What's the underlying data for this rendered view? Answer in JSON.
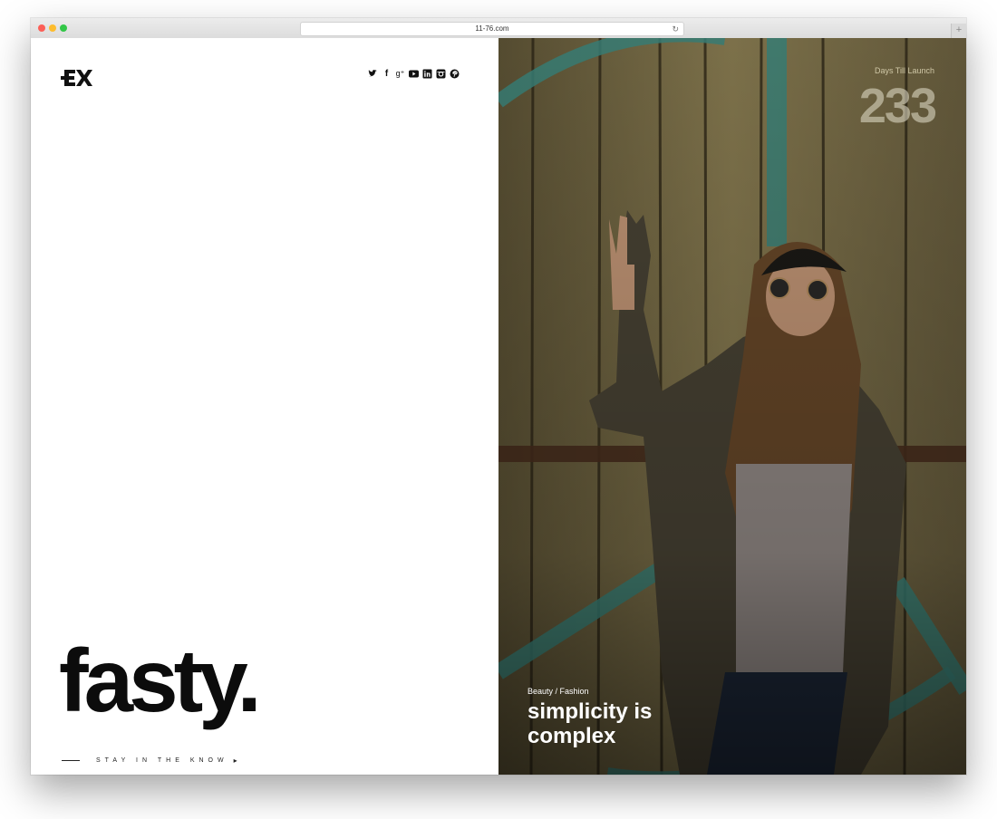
{
  "browser": {
    "url": "11-76.com",
    "reload_icon": "reload-icon",
    "new_tab_symbol": "+"
  },
  "site": {
    "logo_text": "EX",
    "social_icons": [
      "twitter-icon",
      "facebook-icon",
      "google-plus-icon",
      "youtube-icon",
      "linkedin-icon",
      "instagram-icon",
      "pinterest-icon"
    ],
    "brand": "fasty.",
    "stay_label": "STAY IN THE KNOW",
    "stay_arrow": "▸"
  },
  "hero": {
    "days_label": "Days Till Launch",
    "days_count": "233",
    "category": "Beauty / Fashion",
    "headline_line1": "simplicity is",
    "headline_line2": "complex"
  },
  "colors": {
    "accent": "#0c0c0c",
    "overlay": "#6b5f3f"
  }
}
